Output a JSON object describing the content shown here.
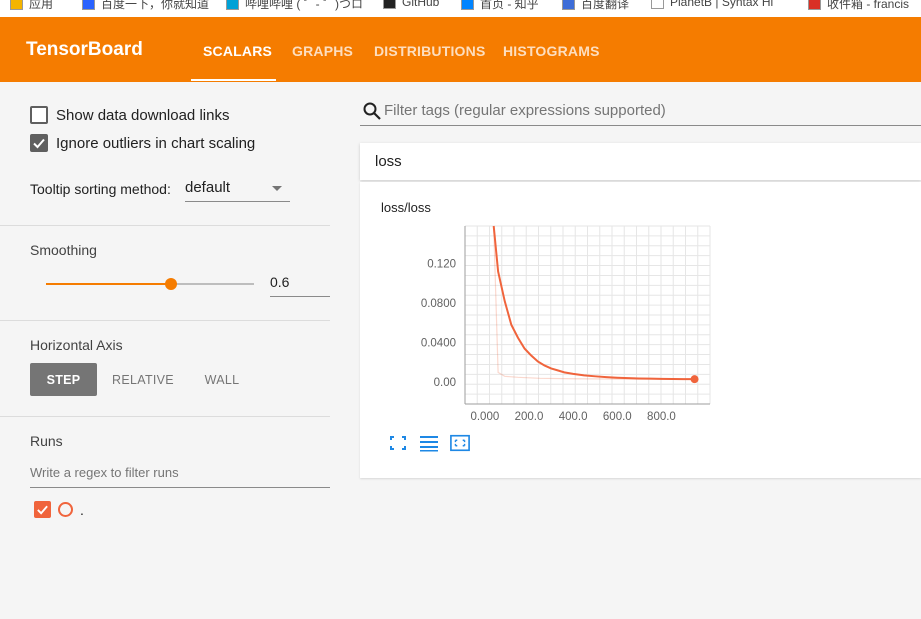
{
  "bookmarks": [
    {
      "label": "应用",
      "x": 10
    },
    {
      "label": "百度一下，你就知道",
      "x": 82
    },
    {
      "label": "哔哩哔哩 ( ゜- ゜)つロ",
      "x": 226
    },
    {
      "label": "GitHub",
      "x": 383
    },
    {
      "label": "首页 - 知乎",
      "x": 461
    },
    {
      "label": "百度翻译",
      "x": 562
    },
    {
      "label": "PlanetB | Syntax Hi",
      "x": 651
    },
    {
      "label": "收件箱 - francis",
      "x": 808
    }
  ],
  "header": {
    "brand": "TensorBoard",
    "tabs": [
      "SCALARS",
      "GRAPHS",
      "DISTRIBUTIONS",
      "HISTOGRAMS"
    ],
    "active_tab": "SCALARS",
    "accent": "#f57c00"
  },
  "sidebar": {
    "show_download_links": {
      "label": "Show data download links",
      "checked": false
    },
    "ignore_outliers": {
      "label": "Ignore outliers in chart scaling",
      "checked": true
    },
    "tooltip_sorting": {
      "label": "Tooltip sorting method:",
      "value": "default"
    },
    "smoothing": {
      "title": "Smoothing",
      "value": "0.6",
      "level": 0.6
    },
    "horizontal_axis": {
      "title": "Horizontal Axis",
      "options": [
        "STEP",
        "RELATIVE",
        "WALL"
      ],
      "selected": "STEP"
    },
    "runs": {
      "title": "Runs",
      "filter_placeholder": "Write a regex to filter runs",
      "items": [
        {
          "label": ".",
          "checked": true,
          "color": "#f0643c"
        }
      ]
    }
  },
  "main": {
    "search_placeholder": "Filter tags (regular expressions supported)",
    "group": "loss",
    "card": {
      "title": "loss/loss"
    }
  },
  "chart_data": {
    "type": "line",
    "title": "loss/loss",
    "x_ticks": [
      "0.000",
      "200.0",
      "400.0",
      "600.0",
      "800.0"
    ],
    "y_ticks": [
      "0.00",
      "0.0400",
      "0.0800",
      "0.120"
    ],
    "xlim": [
      -90,
      1020
    ],
    "ylim": [
      -0.022,
      0.158
    ],
    "grid": true,
    "series": [
      {
        "color": "#f0643c",
        "smoothed_x": [
          40,
          60,
          90,
          120,
          150,
          180,
          210,
          240,
          270,
          300,
          330,
          360,
          400,
          450,
          500,
          550,
          600,
          650,
          700,
          750,
          800,
          850,
          900,
          950
        ],
        "smoothed_y": [
          0.16,
          0.112,
          0.082,
          0.058,
          0.045,
          0.034,
          0.027,
          0.021,
          0.017,
          0.014,
          0.012,
          0.01,
          0.0085,
          0.007,
          0.006,
          0.0052,
          0.0046,
          0.0042,
          0.0038,
          0.0036,
          0.0034,
          0.0033,
          0.0032,
          0.0031
        ],
        "raw_x": [
          40,
          60,
          90,
          150,
          250,
          400,
          600,
          800,
          950
        ],
        "raw_y": [
          0.16,
          0.01,
          0.006,
          0.005,
          0.004,
          0.0035,
          0.0032,
          0.0031,
          0.003
        ]
      }
    ]
  }
}
